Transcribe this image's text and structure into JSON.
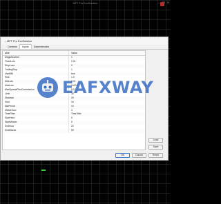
{
  "background": {
    "title": "MFT Pro EvoSolution",
    "controls": [
      "—",
      "❐",
      "✕"
    ]
  },
  "dialog": {
    "title": "– MFT Pro EvoSolution",
    "tabs": [
      "",
      "Common",
      "Inputs",
      "Dependencies"
    ],
    "active_tab": 2,
    "columns": {
      "variable": "able",
      "value": "Value"
    },
    "rows": [
      {
        "name": "MagicNumber",
        "value": "1"
      },
      {
        "name": "FixedLots",
        "value": "0.01"
      },
      {
        "name": "StopLoss",
        "value": "0"
      },
      {
        "name": "TrailingStop",
        "value": "1"
      },
      {
        "name": "UseMM",
        "value": "true"
      },
      {
        "name": "Risk",
        "value": "1.0"
      },
      {
        "name": "MinLots",
        "value": "0.01"
      },
      {
        "name": "MaxLots",
        "value": "1000.0"
      },
      {
        "name": "MaxSpreadPlusCommission",
        "value": "5.0"
      },
      {
        "name": "Limit",
        "value": "30"
      },
      {
        "name": "Distance",
        "value": "25"
      },
      {
        "name": "Hour",
        "value": "16"
      },
      {
        "name": "MAPeriod",
        "value": "10"
      },
      {
        "name": "MAMethod",
        "value": "3"
      },
      {
        "name": "TimeFilter",
        "value": "Time filter"
      },
      {
        "name": "StartHour",
        "value": "0"
      },
      {
        "name": "StartMinute",
        "value": "0"
      },
      {
        "name": "EndHour",
        "value": "22"
      },
      {
        "name": "EndMinute",
        "value": "59"
      }
    ],
    "buttons": {
      "load": "Load",
      "save": "Save",
      "ok": "OK",
      "cancel": "Cancel",
      "reset": "Reset"
    }
  },
  "watermark": {
    "text": "EAFXWAY",
    "color": "#2660be"
  }
}
